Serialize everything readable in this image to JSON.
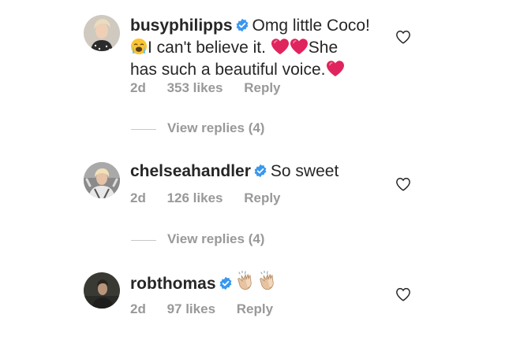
{
  "comments": [
    {
      "username": "busyphilipps",
      "verified": true,
      "text_parts": [
        "Omg little Coco!",
        "I can't believe it.",
        "She",
        "has such a beautiful voice."
      ],
      "emoji_icons": [
        "loudly-crying-face-icon",
        "red-heart-icon",
        "red-heart-icon",
        "red-heart-icon"
      ],
      "time": "2d",
      "likes": "353 likes",
      "reply_label": "Reply",
      "view_replies": "View replies (4)"
    },
    {
      "username": "chelseahandler",
      "verified": true,
      "text_parts": [
        "So sweet"
      ],
      "time": "2d",
      "likes": "126 likes",
      "reply_label": "Reply",
      "view_replies": "View replies (4)"
    },
    {
      "username": "robthomas",
      "verified": true,
      "text_parts": [],
      "emoji_icons": [
        "clapping-hands-icon",
        "clapping-hands-icon"
      ],
      "time": "2d",
      "likes": "97 likes",
      "reply_label": "Reply"
    }
  ],
  "colors": {
    "text": "#262626",
    "meta": "#999999",
    "verified": "#3897f0",
    "heart_emoji": "#e0245e"
  }
}
